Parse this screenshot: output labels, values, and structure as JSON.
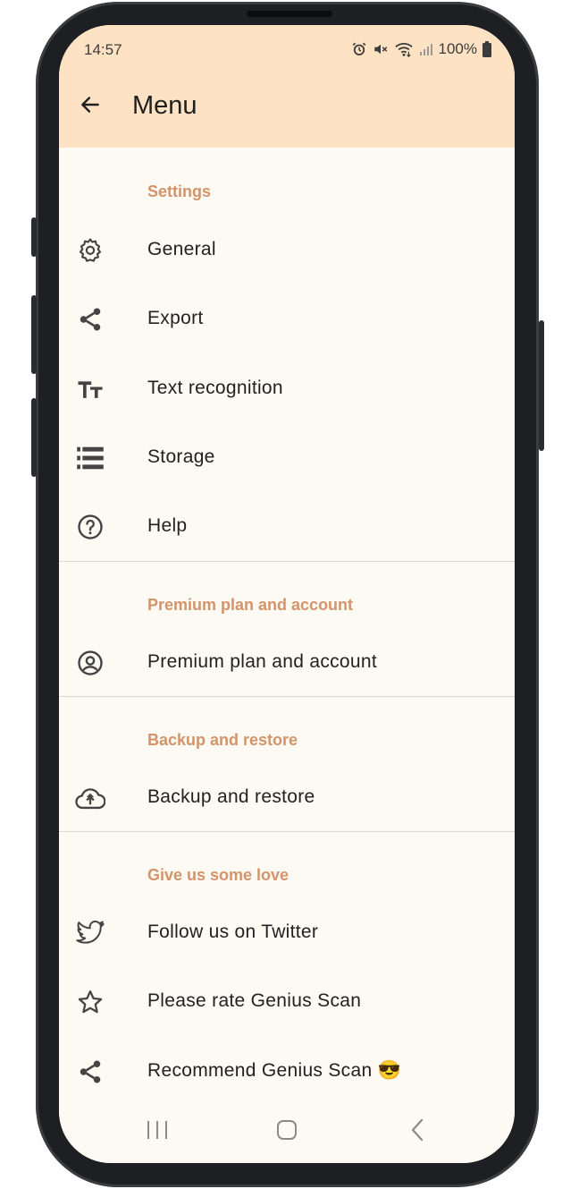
{
  "status_bar": {
    "time": "14:57",
    "battery": "100%",
    "icons": [
      "alarm-icon",
      "mute-icon",
      "wifi-icon",
      "signal-icon",
      "battery-icon"
    ]
  },
  "app_bar": {
    "title": "Menu",
    "back_icon": "arrow-left-icon",
    "background": "#fde2c4"
  },
  "sections": [
    {
      "title": "Settings",
      "items": [
        {
          "label": "General",
          "icon": "gear-icon"
        },
        {
          "label": "Export",
          "icon": "share-icon"
        },
        {
          "label": "Text recognition",
          "icon": "text-size-icon"
        },
        {
          "label": "Storage",
          "icon": "storage-icon"
        },
        {
          "label": "Help",
          "icon": "help-icon"
        }
      ]
    },
    {
      "title": "Premium plan and account",
      "items": [
        {
          "label": "Premium plan and account",
          "icon": "account-icon"
        }
      ]
    },
    {
      "title": "Backup and restore",
      "items": [
        {
          "label": "Backup and restore",
          "icon": "cloud-upload-icon"
        }
      ]
    },
    {
      "title": "Give us some love",
      "items": [
        {
          "label": "Follow us on Twitter",
          "icon": "twitter-icon"
        },
        {
          "label": "Please rate Genius Scan",
          "icon": "star-icon"
        },
        {
          "label": "Recommend Genius Scan 😎",
          "icon": "share-icon"
        }
      ]
    }
  ],
  "nav_bar": {
    "buttons": [
      "recents-icon",
      "home-icon",
      "back-icon"
    ]
  },
  "colors": {
    "accent": "#d3946a",
    "background": "#fdf9f3",
    "header": "#fde2c4"
  }
}
